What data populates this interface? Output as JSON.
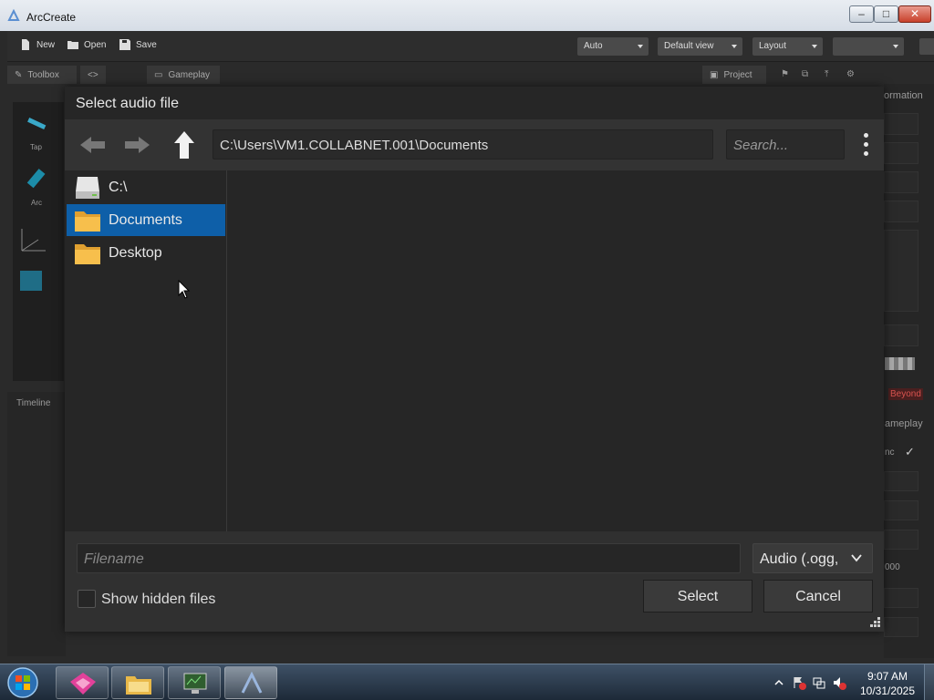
{
  "window": {
    "title": "ArcCreate"
  },
  "toolbar": {
    "new_label": "New",
    "open_label": "Open",
    "save_label": "Save",
    "selects": [
      "Auto",
      "Default view",
      "Layout",
      ""
    ]
  },
  "panels": {
    "toolbox": "Toolbox",
    "code_tab": "<>",
    "gameplay": "Gameplay",
    "project": "Project",
    "timeline": "Timeline",
    "tap_label": "Tap",
    "arc_label": "Arc",
    "information_partial": "ormation",
    "beyond_label": "Beyond",
    "gameplay_right_partial": "ameplay",
    "sync_partial": "nc",
    "number_partial": "000"
  },
  "dialog": {
    "title": "Select audio file",
    "path": "C:\\Users\\VM1.COLLABNET.001\\Documents",
    "search_placeholder": "Search...",
    "sidebar_items": [
      {
        "label": "C:\\",
        "icon": "drive-icon",
        "selected": false
      },
      {
        "label": "Documents",
        "icon": "folder-icon",
        "selected": true
      },
      {
        "label": "Desktop",
        "icon": "folder-icon",
        "selected": false
      }
    ],
    "filename_placeholder": "Filename",
    "filter_value": "Audio (.ogg,",
    "show_hidden_label": "Show hidden files",
    "show_hidden_checked": false,
    "select_label": "Select",
    "cancel_label": "Cancel"
  },
  "taskbar": {
    "time": "9:07 AM",
    "date": "10/31/2025"
  },
  "colors": {
    "selection": "#0e5fa8",
    "folder": "#f3b33c",
    "beyond": "#c0392b"
  }
}
